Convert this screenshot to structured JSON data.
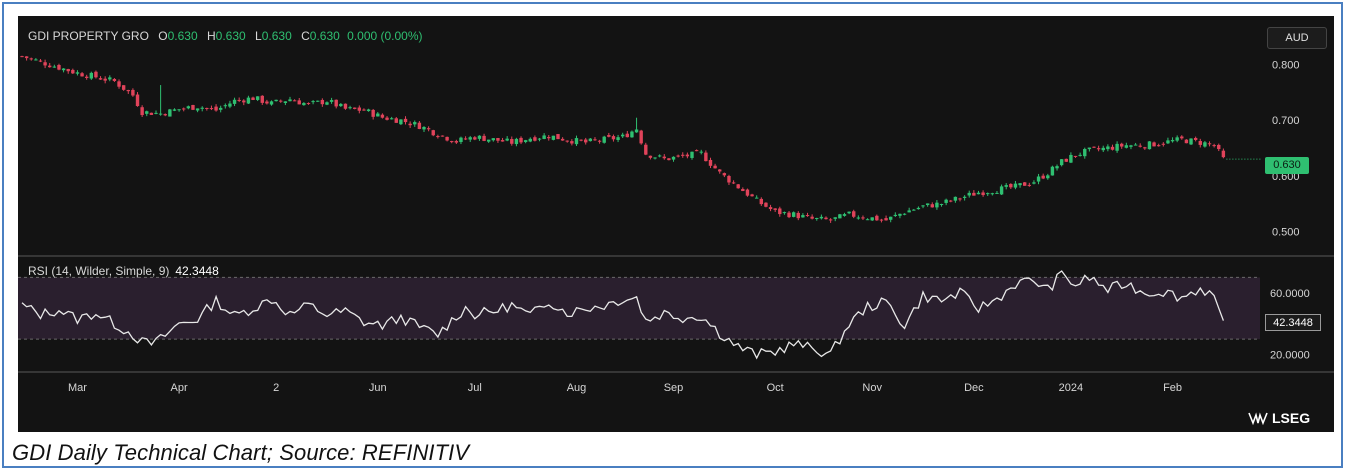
{
  "header": {
    "symbol": "GDI PROPERTY GRO",
    "o_key": "O",
    "o_val": "0.630",
    "h_key": "H",
    "h_val": "0.630",
    "l_key": "L",
    "l_val": "0.630",
    "c_key": "C",
    "c_val": "0.630",
    "change": "0.000 (0.00%)"
  },
  "currency_button": "AUD",
  "last_price_label": "0.630",
  "rsi_header": {
    "label": "RSI (14, Wilder, Simple, 9)",
    "value": "42.3448"
  },
  "rsi_last_label": "42.3448",
  "logo_text": "LSEG",
  "caption": "GDI Daily Technical Chart; Source: REFINITIV",
  "colors": {
    "up": "#2fbf71",
    "down": "#e0435a",
    "rsi_line": "#e8e8e8",
    "rsi_band": "#2a1f2e",
    "background": "#131313"
  },
  "chart_data": [
    {
      "type": "candlestick",
      "title": "",
      "ylabel": "",
      "ylim": [
        0.47,
        0.83
      ],
      "y_ticks": [
        "0.800",
        "0.700",
        "0.600",
        "0.500"
      ],
      "y_tick_values": [
        0.8,
        0.7,
        0.6,
        0.5
      ],
      "x_ticks": [
        "Mar",
        "Apr",
        "2",
        "Jun",
        "Jul",
        "Aug",
        "Sep",
        "Oct",
        "Nov",
        "Dec",
        "2024",
        "Feb"
      ],
      "x_tick_positions": [
        12,
        34,
        55,
        77,
        98,
        120,
        141,
        163,
        184,
        206,
        227,
        249
      ],
      "series_close_by_session": [
        [
          0,
          0.815
        ],
        [
          4,
          0.805
        ],
        [
          8,
          0.795
        ],
        [
          12,
          0.785
        ],
        [
          16,
          0.778
        ],
        [
          20,
          0.77
        ],
        [
          24,
          0.745
        ],
        [
          26,
          0.715
        ],
        [
          30,
          0.712
        ],
        [
          34,
          0.72
        ],
        [
          38,
          0.725
        ],
        [
          42,
          0.718
        ],
        [
          46,
          0.735
        ],
        [
          50,
          0.74
        ],
        [
          54,
          0.73
        ],
        [
          58,
          0.738
        ],
        [
          62,
          0.728
        ],
        [
          66,
          0.735
        ],
        [
          70,
          0.72
        ],
        [
          74,
          0.718
        ],
        [
          78,
          0.705
        ],
        [
          82,
          0.7
        ],
        [
          86,
          0.69
        ],
        [
          90,
          0.675
        ],
        [
          94,
          0.662
        ],
        [
          98,
          0.67
        ],
        [
          102,
          0.665
        ],
        [
          106,
          0.66
        ],
        [
          110,
          0.668
        ],
        [
          114,
          0.672
        ],
        [
          118,
          0.665
        ],
        [
          122,
          0.66
        ],
        [
          126,
          0.665
        ],
        [
          130,
          0.67
        ],
        [
          133,
          0.685
        ],
        [
          135,
          0.64
        ],
        [
          139,
          0.63
        ],
        [
          143,
          0.635
        ],
        [
          147,
          0.64
        ],
        [
          151,
          0.605
        ],
        [
          155,
          0.58
        ],
        [
          159,
          0.555
        ],
        [
          163,
          0.535
        ],
        [
          167,
          0.53
        ],
        [
          171,
          0.522
        ],
        [
          175,
          0.52
        ],
        [
          179,
          0.53
        ],
        [
          183,
          0.525
        ],
        [
          187,
          0.52
        ],
        [
          191,
          0.535
        ],
        [
          195,
          0.545
        ],
        [
          199,
          0.55
        ],
        [
          203,
          0.56
        ],
        [
          207,
          0.57
        ],
        [
          211,
          0.575
        ],
        [
          215,
          0.58
        ],
        [
          219,
          0.59
        ],
        [
          222,
          0.605
        ],
        [
          225,
          0.625
        ],
        [
          228,
          0.638
        ],
        [
          231,
          0.645
        ],
        [
          235,
          0.65
        ],
        [
          239,
          0.655
        ],
        [
          243,
          0.655
        ],
        [
          247,
          0.66
        ],
        [
          251,
          0.665
        ],
        [
          255,
          0.66
        ],
        [
          258,
          0.655
        ],
        [
          260,
          0.63
        ]
      ],
      "last_price": 0.63
    },
    {
      "type": "line",
      "title": "",
      "series": [
        {
          "name": "RSI (14, Wilder, Simple, 9)",
          "x": [
            0,
            4,
            8,
            12,
            16,
            20,
            24,
            26,
            28,
            30,
            34,
            38,
            42,
            46,
            50,
            54,
            58,
            62,
            66,
            70,
            74,
            78,
            82,
            86,
            90,
            94,
            96,
            98,
            102,
            106,
            110,
            114,
            118,
            122,
            126,
            130,
            133,
            135,
            139,
            143,
            147,
            151,
            155,
            159,
            163,
            167,
            171,
            175,
            179,
            183,
            187,
            191,
            195,
            199,
            203,
            207,
            211,
            215,
            219,
            222,
            225,
            228,
            231,
            235,
            239,
            243,
            247,
            251,
            255,
            258,
            260
          ],
          "values": [
            52,
            46,
            49,
            43,
            47,
            40,
            33,
            28,
            27,
            30,
            40,
            43,
            55,
            45,
            50,
            56,
            46,
            52,
            46,
            48,
            41,
            39,
            44,
            38,
            33,
            45,
            50,
            46,
            48,
            52,
            45,
            55,
            47,
            50,
            52,
            56,
            57,
            42,
            47,
            44,
            45,
            34,
            25,
            20,
            22,
            27,
            24,
            20,
            40,
            51,
            54,
            39,
            58,
            55,
            60,
            50,
            56,
            66,
            68,
            62,
            72,
            65,
            70,
            62,
            66,
            60,
            61,
            57,
            63,
            58,
            42
          ]
        }
      ],
      "ylim": [
        10,
        80
      ],
      "y_ticks": [
        "60.0000",
        "20.0000"
      ],
      "y_tick_values": [
        60,
        20
      ],
      "band": [
        30,
        70
      ],
      "last_value": 42.3448
    }
  ]
}
